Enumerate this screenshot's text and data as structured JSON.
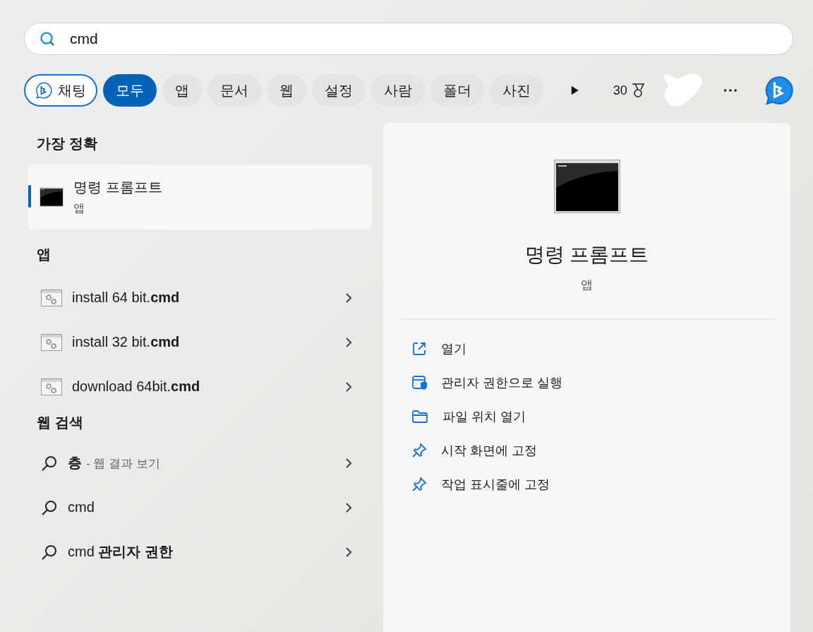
{
  "search": {
    "value": "cmd"
  },
  "filters": [
    {
      "label": "채팅",
      "kind": "chat",
      "selected": false
    },
    {
      "label": "모두",
      "kind": "chip",
      "selected": true
    },
    {
      "label": "앱",
      "kind": "chip",
      "selected": false
    },
    {
      "label": "문서",
      "kind": "chip",
      "selected": false
    },
    {
      "label": "웹",
      "kind": "chip",
      "selected": false
    },
    {
      "label": "설정",
      "kind": "chip",
      "selected": false
    },
    {
      "label": "사람",
      "kind": "chip",
      "selected": false
    },
    {
      "label": "폴더",
      "kind": "chip",
      "selected": false
    },
    {
      "label": "사진",
      "kind": "chip",
      "selected": false
    }
  ],
  "points": "30",
  "best_match": {
    "heading": "가장 정확",
    "title": "명령 프롬프트",
    "subtitle": "앱",
    "selected": true
  },
  "apps": {
    "heading": "앱",
    "items": [
      {
        "label": "install 64 bit.**cmd**"
      },
      {
        "label": "install 32 bit.**cmd**"
      },
      {
        "label": "download 64bit.**cmd**"
      }
    ]
  },
  "web": {
    "heading": "웹 검색",
    "items": [
      {
        "query": "**층**",
        "suffix": "- 웹 결과 보기"
      },
      {
        "query": "cmd"
      },
      {
        "query": "cmd **관리자 권한**"
      }
    ]
  },
  "detail": {
    "title": "명령 프롬프트",
    "subtitle": "앱",
    "actions": [
      {
        "label": "열기",
        "kind": "open"
      },
      {
        "label": "관리자 권한으로 실행",
        "kind": "admin"
      },
      {
        "label": "파일 위치 열기",
        "kind": "folder"
      },
      {
        "label": "시작 화면에 고정",
        "kind": "pin"
      },
      {
        "label": "작업 표시줄에 고정",
        "kind": "pin"
      }
    ]
  }
}
